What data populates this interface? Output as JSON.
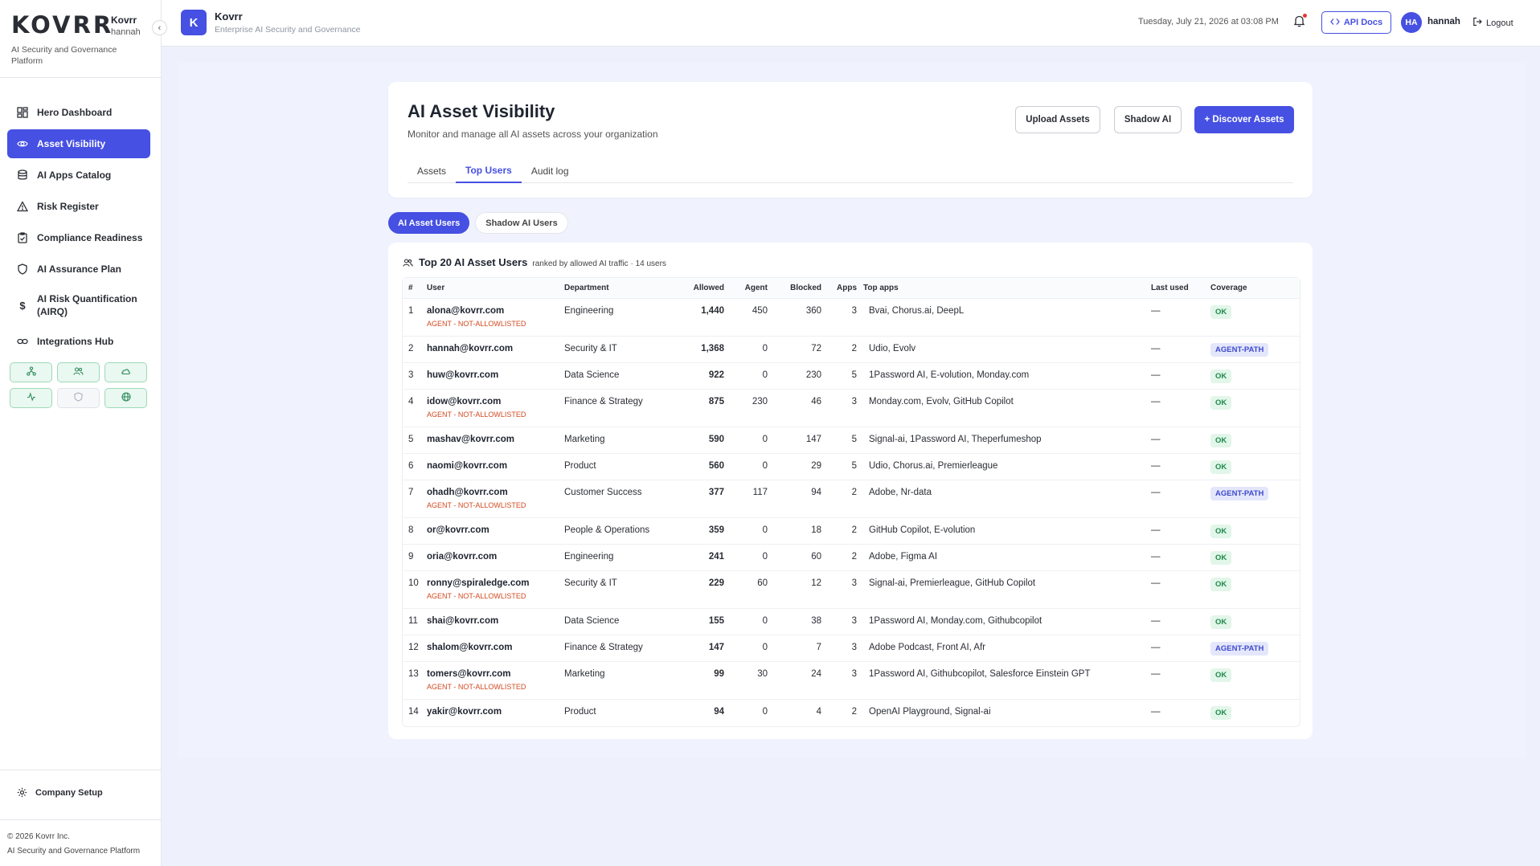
{
  "sidebar": {
    "logo": "KOVRR",
    "org": "Kovrr",
    "user": "hannah",
    "tagline": "AI Security and Governance Platform",
    "items": [
      {
        "label": "Hero Dashboard",
        "icon": "dashboard-icon",
        "active": false
      },
      {
        "label": "Asset Visibility",
        "icon": "eye-icon",
        "active": true
      },
      {
        "label": "AI Apps Catalog",
        "icon": "database-icon",
        "active": false
      },
      {
        "label": "Risk Register",
        "icon": "warning-icon",
        "active": false
      },
      {
        "label": "Compliance Readiness",
        "icon": "clipboard-check-icon",
        "active": false
      },
      {
        "label": "AI Assurance Plan",
        "icon": "shield-icon",
        "active": false
      },
      {
        "label": "AI Risk Quantification (AIRQ)",
        "icon": "dollar-icon",
        "active": false
      },
      {
        "label": "Integrations Hub",
        "icon": "link-icon",
        "active": false
      }
    ],
    "quick_icons": [
      "network-icon",
      "users-icon",
      "cloud-icon",
      "activity-icon",
      "shield-outline-icon",
      "globe-icon"
    ],
    "company_setup": "Company Setup",
    "footer_copyright": "© 2026 Kovrr Inc.",
    "footer_tagline": "AI Security and Governance Platform"
  },
  "header": {
    "logo_letter": "K",
    "title": "Kovrr",
    "subtitle": "Enterprise AI Security and Governance",
    "datetime": "Tuesday, July 21, 2026 at 03:08 PM",
    "api_docs": "API Docs",
    "avatar_initials": "HA",
    "user": "hannah",
    "logout": "Logout"
  },
  "page": {
    "title": "AI Asset Visibility",
    "subtitle": "Monitor and manage all AI assets across your organization",
    "buttons": {
      "upload": "Upload Assets",
      "shadow": "Shadow AI",
      "discover": "+ Discover Assets"
    },
    "tabs": [
      {
        "label": "Assets",
        "active": false
      },
      {
        "label": "Top Users",
        "active": true
      },
      {
        "label": "Audit log",
        "active": false
      }
    ],
    "pills": [
      {
        "label": "AI Asset Users",
        "active": true
      },
      {
        "label": "Shadow AI Users",
        "active": false
      }
    ]
  },
  "table": {
    "title": "Top 20 AI Asset Users",
    "meta": "ranked by allowed AI traffic · 14 users",
    "columns": [
      "#",
      "User",
      "Department",
      "Allowed",
      "Agent",
      "Blocked",
      "Apps",
      "Top apps",
      "Last used",
      "Coverage"
    ],
    "rows": [
      {
        "rank": "1",
        "user": "alona@kovrr.com",
        "flag": "AGENT - NOT-ALLOWLISTED",
        "dept": "Engineering",
        "allowed": "1,440",
        "agent": "450",
        "blocked": "360",
        "apps": "3",
        "top_apps": "Bvai, Chorus.ai, DeepL",
        "last_used": "—",
        "coverage": "OK"
      },
      {
        "rank": "2",
        "user": "hannah@kovrr.com",
        "flag": "",
        "dept": "Security & IT",
        "allowed": "1,368",
        "agent": "0",
        "blocked": "72",
        "apps": "2",
        "top_apps": "Udio, Evolv",
        "last_used": "—",
        "coverage": "AGENT-PATH"
      },
      {
        "rank": "3",
        "user": "huw@kovrr.com",
        "flag": "",
        "dept": "Data Science",
        "allowed": "922",
        "agent": "0",
        "blocked": "230",
        "apps": "5",
        "top_apps": "1Password AI, E-volution, Monday.com",
        "last_used": "—",
        "coverage": "OK"
      },
      {
        "rank": "4",
        "user": "idow@kovrr.com",
        "flag": "AGENT - NOT-ALLOWLISTED",
        "dept": "Finance & Strategy",
        "allowed": "875",
        "agent": "230",
        "blocked": "46",
        "apps": "3",
        "top_apps": "Monday.com, Evolv, GitHub Copilot",
        "last_used": "—",
        "coverage": "OK"
      },
      {
        "rank": "5",
        "user": "mashav@kovrr.com",
        "flag": "",
        "dept": "Marketing",
        "allowed": "590",
        "agent": "0",
        "blocked": "147",
        "apps": "5",
        "top_apps": "Signal-ai, 1Password AI, Theperfumeshop",
        "last_used": "—",
        "coverage": "OK"
      },
      {
        "rank": "6",
        "user": "naomi@kovrr.com",
        "flag": "",
        "dept": "Product",
        "allowed": "560",
        "agent": "0",
        "blocked": "29",
        "apps": "5",
        "top_apps": "Udio, Chorus.ai, Premierleague",
        "last_used": "—",
        "coverage": "OK"
      },
      {
        "rank": "7",
        "user": "ohadh@kovrr.com",
        "flag": "AGENT - NOT-ALLOWLISTED",
        "dept": "Customer Success",
        "allowed": "377",
        "agent": "117",
        "blocked": "94",
        "apps": "2",
        "top_apps": "Adobe, Nr-data",
        "last_used": "—",
        "coverage": "AGENT-PATH"
      },
      {
        "rank": "8",
        "user": "or@kovrr.com",
        "flag": "",
        "dept": "People & Operations",
        "allowed": "359",
        "agent": "0",
        "blocked": "18",
        "apps": "2",
        "top_apps": "GitHub Copilot, E-volution",
        "last_used": "—",
        "coverage": "OK"
      },
      {
        "rank": "9",
        "user": "oria@kovrr.com",
        "flag": "",
        "dept": "Engineering",
        "allowed": "241",
        "agent": "0",
        "blocked": "60",
        "apps": "2",
        "top_apps": "Adobe, Figma AI",
        "last_used": "—",
        "coverage": "OK"
      },
      {
        "rank": "10",
        "user": "ronny@spiraledge.com",
        "flag": "AGENT - NOT-ALLOWLISTED",
        "dept": "Security & IT",
        "allowed": "229",
        "agent": "60",
        "blocked": "12",
        "apps": "3",
        "top_apps": "Signal-ai, Premierleague, GitHub Copilot",
        "last_used": "—",
        "coverage": "OK"
      },
      {
        "rank": "11",
        "user": "shai@kovrr.com",
        "flag": "",
        "dept": "Data Science",
        "allowed": "155",
        "agent": "0",
        "blocked": "38",
        "apps": "3",
        "top_apps": "1Password AI, Monday.com, Githubcopilot",
        "last_used": "—",
        "coverage": "OK"
      },
      {
        "rank": "12",
        "user": "shalom@kovrr.com",
        "flag": "",
        "dept": "Finance & Strategy",
        "allowed": "147",
        "agent": "0",
        "blocked": "7",
        "apps": "3",
        "top_apps": "Adobe Podcast, Front AI, Afr",
        "last_used": "—",
        "coverage": "AGENT-PATH"
      },
      {
        "rank": "13",
        "user": "tomers@kovrr.com",
        "flag": "AGENT - NOT-ALLOWLISTED",
        "dept": "Marketing",
        "allowed": "99",
        "agent": "30",
        "blocked": "24",
        "apps": "3",
        "top_apps": "1Password AI, Githubcopilot, Salesforce Einstein GPT",
        "last_used": "—",
        "coverage": "OK"
      },
      {
        "rank": "14",
        "user": "yakir@kovrr.com",
        "flag": "",
        "dept": "Product",
        "allowed": "94",
        "agent": "0",
        "blocked": "4",
        "apps": "2",
        "top_apps": "OpenAI Playground, Signal-ai",
        "last_used": "—",
        "coverage": "OK"
      }
    ]
  },
  "colors": {
    "accent": "#4650e2",
    "agent": "#8a33d8",
    "blocked": "#d93a3a",
    "flag": "#d2491f",
    "ok": "#1f8a4c"
  }
}
